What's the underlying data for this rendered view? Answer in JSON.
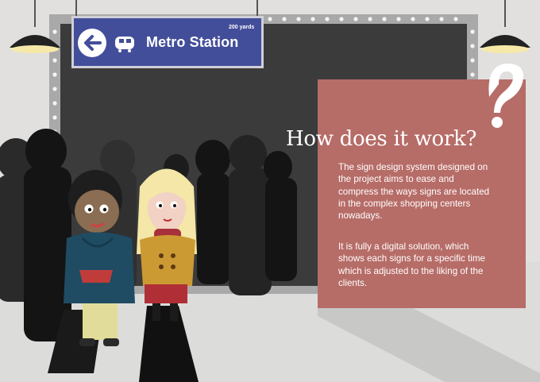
{
  "sign": {
    "distance": "200 yards",
    "title": "Metro Station",
    "arrow_icon": "left-arrow-icon",
    "train_icon": "train-icon"
  },
  "info": {
    "heading": "How does it work?",
    "paragraph_1": "The sign design system designed on the project aims to ease and compress the ways signs are located in the complex shopping centers nowadays.",
    "paragraph_2": "It is fully a digital solution, which shows each signs for a specific time which is adjusted to the liking of the clients.",
    "question_mark_icon": "question-mark-icon"
  },
  "colors": {
    "background": "#e1e0de",
    "board": "#3c3c3c",
    "board_frame": "#a8a8a8",
    "sign": "#434e9a",
    "panel": "#b66c67",
    "panel_shadow": "#cacaca",
    "lamp": "#222222",
    "lamp_glow": "#f6e9a8"
  }
}
